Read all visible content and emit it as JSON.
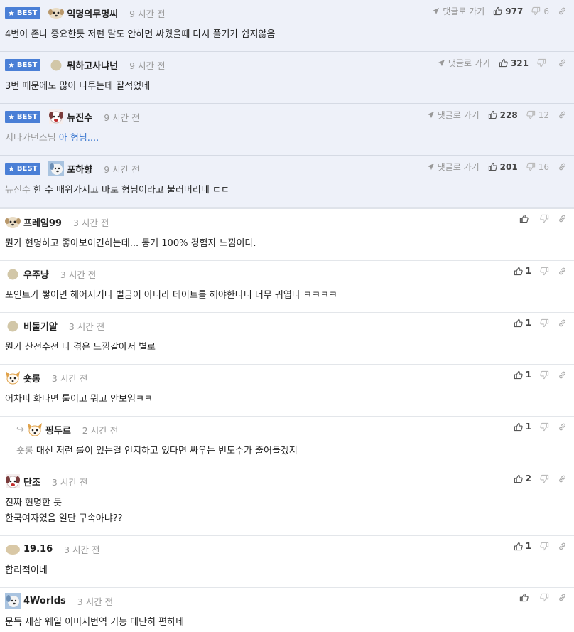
{
  "best_label": "BEST",
  "goto_label": "댓글로 가기",
  "best_comments": [
    {
      "nick": "익명의무명씨",
      "time": "9 시간 전",
      "likes": "977",
      "dislikes": "6",
      "text": "4번이 존나 중요한듯 저런 말도 안하면 싸웠을때 다시 풀기가 쉽지않음",
      "mention": "",
      "avatar": "dog-avatar-icon"
    },
    {
      "nick": "뭐하고사냐넌",
      "time": "9 시간 전",
      "likes": "321",
      "dislikes": "",
      "text": "3번 때문에도 많이 다투는데 잘적었네",
      "mention": "",
      "avatar": "blob-avatar-icon"
    },
    {
      "nick": "뉴진수",
      "time": "9 시간 전",
      "likes": "228",
      "dislikes": "12",
      "mention": "지나가던스님",
      "text": "아 형님....",
      "avatar": "puppy-avatar-icon"
    },
    {
      "nick": "포하향",
      "time": "9 시간 전",
      "likes": "201",
      "dislikes": "16",
      "mention": "뉴진수",
      "text": "한 수 배워가지고 바로 형님이라고 불러버리네 ㄷㄷ",
      "avatar": "blue-dog-avatar-icon"
    }
  ],
  "comments": [
    {
      "nick": "프레임99",
      "time": "3 시간 전",
      "likes": "",
      "mention": "",
      "lines": [
        "뭔가 현명하고 좋아보이긴하는데... 동거 100% 경험자 느낌이다."
      ],
      "avatar": "dog-avatar-icon",
      "reply": false
    },
    {
      "nick": "우주냥",
      "time": "3 시간 전",
      "likes": "1",
      "mention": "",
      "lines": [
        "포인트가 쌓이면 헤어지거나 벌금이 아니라 데이트를 해야한다니 너무 귀엽다 ㅋㅋㅋㅋ"
      ],
      "avatar": "blob-avatar-icon",
      "reply": false
    },
    {
      "nick": "비둘기알",
      "time": "3 시간 전",
      "likes": "1",
      "mention": "",
      "lines": [
        "뭔가 산전수전 다 겪은 느낌같아서 별로"
      ],
      "avatar": "blob-avatar-icon",
      "reply": false
    },
    {
      "nick": "숏롱",
      "time": "3 시간 전",
      "likes": "1",
      "mention": "",
      "lines": [
        "어차피 화나면 룰이고 뭐고 안보임ㅋㅋ"
      ],
      "avatar": "fox-avatar-icon",
      "reply": false
    },
    {
      "nick": "핑두르",
      "time": "2 시간 전",
      "likes": "1",
      "mention": "숏롱",
      "lines": [
        "대신 저런 룰이 있는걸 인지하고 있다면 싸우는 빈도수가 줄어들겠지"
      ],
      "avatar": "fox-avatar-icon",
      "reply": true
    },
    {
      "nick": "단조",
      "time": "3 시간 전",
      "likes": "2",
      "mention": "",
      "lines": [
        "진짜 현명한 듯",
        "한국여자였음 일단 구속아냐??"
      ],
      "avatar": "puppy-avatar-icon",
      "reply": false
    },
    {
      "nick": "19.16",
      "time": "3 시간 전",
      "likes": "1",
      "mention": "",
      "lines": [
        "합리적이네"
      ],
      "avatar": "potato-avatar-icon",
      "reply": false
    },
    {
      "nick": "4Worlds",
      "time": "3 시간 전",
      "likes": "",
      "mention": "",
      "lines": [
        "문득 새삼 웨일 이미지번역 기능 대단히 편하네"
      ],
      "avatar": "blue-dog-avatar-icon",
      "reply": false
    }
  ]
}
